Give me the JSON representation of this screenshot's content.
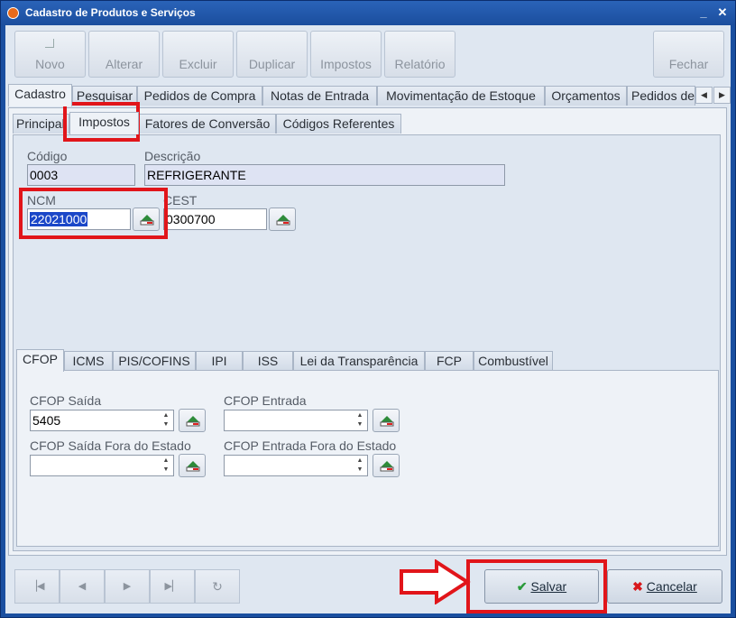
{
  "window": {
    "title": "Cadastro de Produtos e Serviços",
    "minimize": "_",
    "close": "✕"
  },
  "toolbar": {
    "novo": "Novo",
    "alterar": "Alterar",
    "excluir": "Excluir",
    "duplicar": "Duplicar",
    "impostos": "Impostos",
    "relatorio": "Relatório",
    "fechar": "Fechar"
  },
  "main_tabs": [
    "Cadastro",
    "Pesquisar",
    "Pedidos de Compra",
    "Notas de Entrada",
    "Movimentação de Estoque",
    "Orçamentos",
    "Pedidos de"
  ],
  "sub_tabs": [
    "Principal",
    "Impostos",
    "Fatores de Conversão",
    "Códigos Referentes"
  ],
  "product": {
    "codigo_label": "Código",
    "codigo": "0003",
    "descricao_label": "Descrição",
    "descricao": "REFRIGERANTE",
    "ncm_label": "NCM",
    "ncm": "22021000",
    "cest_label": "CEST",
    "cest": "0300700"
  },
  "tax_tabs": [
    "CFOP",
    "ICMS",
    "PIS/COFINS",
    "IPI",
    "ISS",
    "Lei da Transparência",
    "FCP",
    "Combustível"
  ],
  "cfop": {
    "saida_label": "CFOP Saída",
    "saida": "5405",
    "entrada_label": "CFOP Entrada",
    "entrada": "",
    "saida_fora_label": "CFOP Saída Fora do Estado",
    "saida_fora": "",
    "entrada_fora_label": "CFOP Entrada Fora do Estado",
    "entrada_fora": ""
  },
  "footer": {
    "salvar": "Salvar",
    "cancelar": "Cancelar"
  },
  "colors": {
    "highlight": "#e1151a",
    "title_bar": "#1b4e9e"
  }
}
